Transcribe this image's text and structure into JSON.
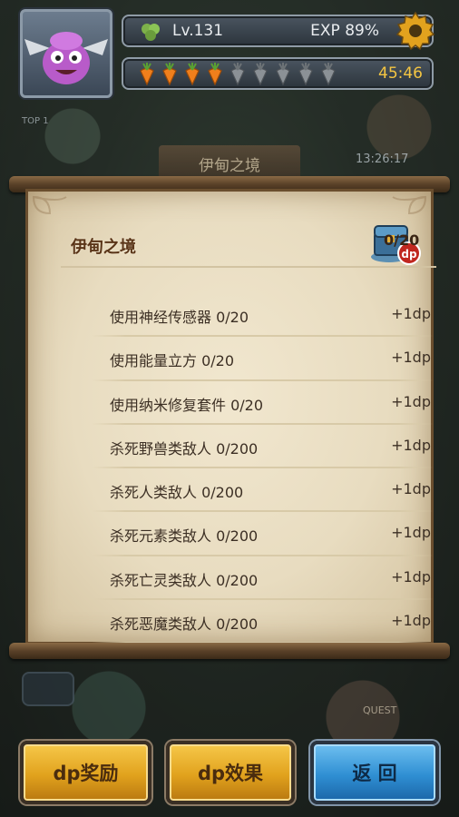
{
  "player": {
    "level_label": "Lv.131",
    "exp_label": "EXP 89%",
    "exp_percent": 89,
    "energy_total": 9,
    "energy_filled": 4,
    "timer": "45:46"
  },
  "background": {
    "ticket_text": "TOP 1",
    "map_timer": "13:26:17",
    "plaque_title": "伊甸之境",
    "quest_sign": "QUEST"
  },
  "panel": {
    "title": "伊甸之境",
    "progress": "0/20",
    "rows": [
      {
        "label": "使用神经传感器 0/20",
        "reward": "+1dp"
      },
      {
        "label": "使用能量立方 0/20",
        "reward": "+1dp"
      },
      {
        "label": "使用纳米修复套件 0/20",
        "reward": "+1dp"
      },
      {
        "label": "杀死野兽类敌人 0/200",
        "reward": "+1dp"
      },
      {
        "label": "杀死人类敌人 0/200",
        "reward": "+1dp"
      },
      {
        "label": "杀死元素类敌人 0/200",
        "reward": "+1dp"
      },
      {
        "label": "杀死亡灵类敌人 0/200",
        "reward": "+1dp"
      },
      {
        "label": "杀死恶魔类敌人 0/200",
        "reward": "+1dp"
      }
    ]
  },
  "buttons": {
    "dp_reward": "dp奖励",
    "dp_effect": "dp效果",
    "back": "返 回"
  },
  "colors": {
    "gold_button": "#e1a21d",
    "blue_button": "#2f8fd3",
    "timer": "#f4c542",
    "parchment": "#e8dcc0"
  }
}
